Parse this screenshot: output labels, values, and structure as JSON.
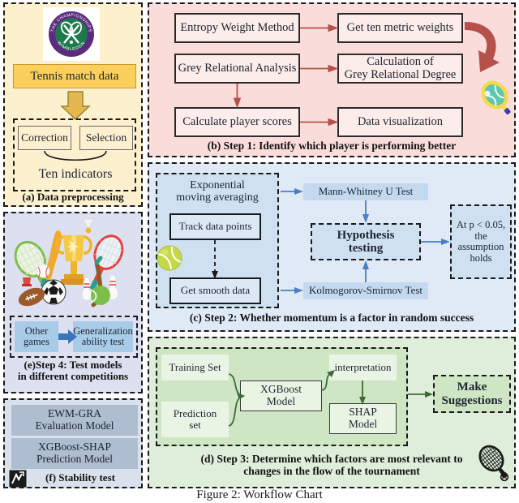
{
  "figure": {
    "caption": "Figure 2: Workflow Chart"
  },
  "colors": {
    "panel_a_bg": "#fdf0cf",
    "panel_b_bg": "#fadddb",
    "panel_c_bg": "#dfeaf6",
    "panel_d_bg": "#dfeeda",
    "panel_e_bg": "#dde0f0",
    "panel_f_bg": "#d9e2ec",
    "accent_yellow": "#fbcf5c",
    "arrow_red": "#b5504a",
    "arrow_blue": "#4a7fc1",
    "arrow_green": "#3c6b38",
    "wimbledon_purple": "#5c2a7e",
    "wimbledon_green": "#1e7a4c"
  },
  "panel_a": {
    "logo": {
      "name": "wimbledon-logo",
      "top_text": "THE CHAMPIONSHIPS",
      "bottom_text": "WIMBLEDON"
    },
    "data_box": "Tennis match data",
    "steps": [
      "Correction",
      "Selection"
    ],
    "result": "Ten indicators",
    "caption": "(a) Data preprocessing"
  },
  "panel_b": {
    "boxes": [
      "Entropy Weight Method",
      "Get ten metric weights",
      "Grey Relational Analysis",
      "Calculation of\nGrey Relational Degree",
      "Calculate player scores",
      "Data visualization"
    ],
    "icon": "tennis-racket-icon",
    "caption": "(b) Step 1: Identify which player is performing better"
  },
  "panel_c": {
    "ema_label": "Exponential\nmoving averaging",
    "track": "Track data points",
    "smooth": "Get smooth data",
    "ball_icon": "tennis-ball-icon",
    "test_mann_whitney": "Mann-Whitney  U Test",
    "test_kolmogorov": "Kolmogorov-Smirnov Test",
    "hypothesis": "Hypothesis\ntesting",
    "conclusion": "At p < 0.05,\nthe\nassumption\nholds",
    "caption": "(c) Step 2: Whether momentum is a factor in random success"
  },
  "panel_d": {
    "training_set": "Training  Set",
    "prediction_set": "Prediction\nset",
    "xgboost": "XGBoost\nModel",
    "interpretation": "interpretation",
    "shap": "SHAP\nModel",
    "suggestions": "Make\nSuggestions",
    "icon": "tennis-racket-icon",
    "caption": "(d) Step 3: Determine which factors are most relevant to\nchanges in the flow of the tournament"
  },
  "panel_e": {
    "collage": "sports-equipment-collage",
    "other_games": "Other\ngames",
    "generalization": "Generalization\nability test",
    "caption": "(e)Step 4: Test models\nin different competitions"
  },
  "panel_f": {
    "model_1": "EWM-GRA\nEvaluation Model",
    "model_2": "XGBoost-SHAP\nPrediction Model",
    "icon": "stability-test-icon",
    "caption": "(f) Stability test"
  }
}
